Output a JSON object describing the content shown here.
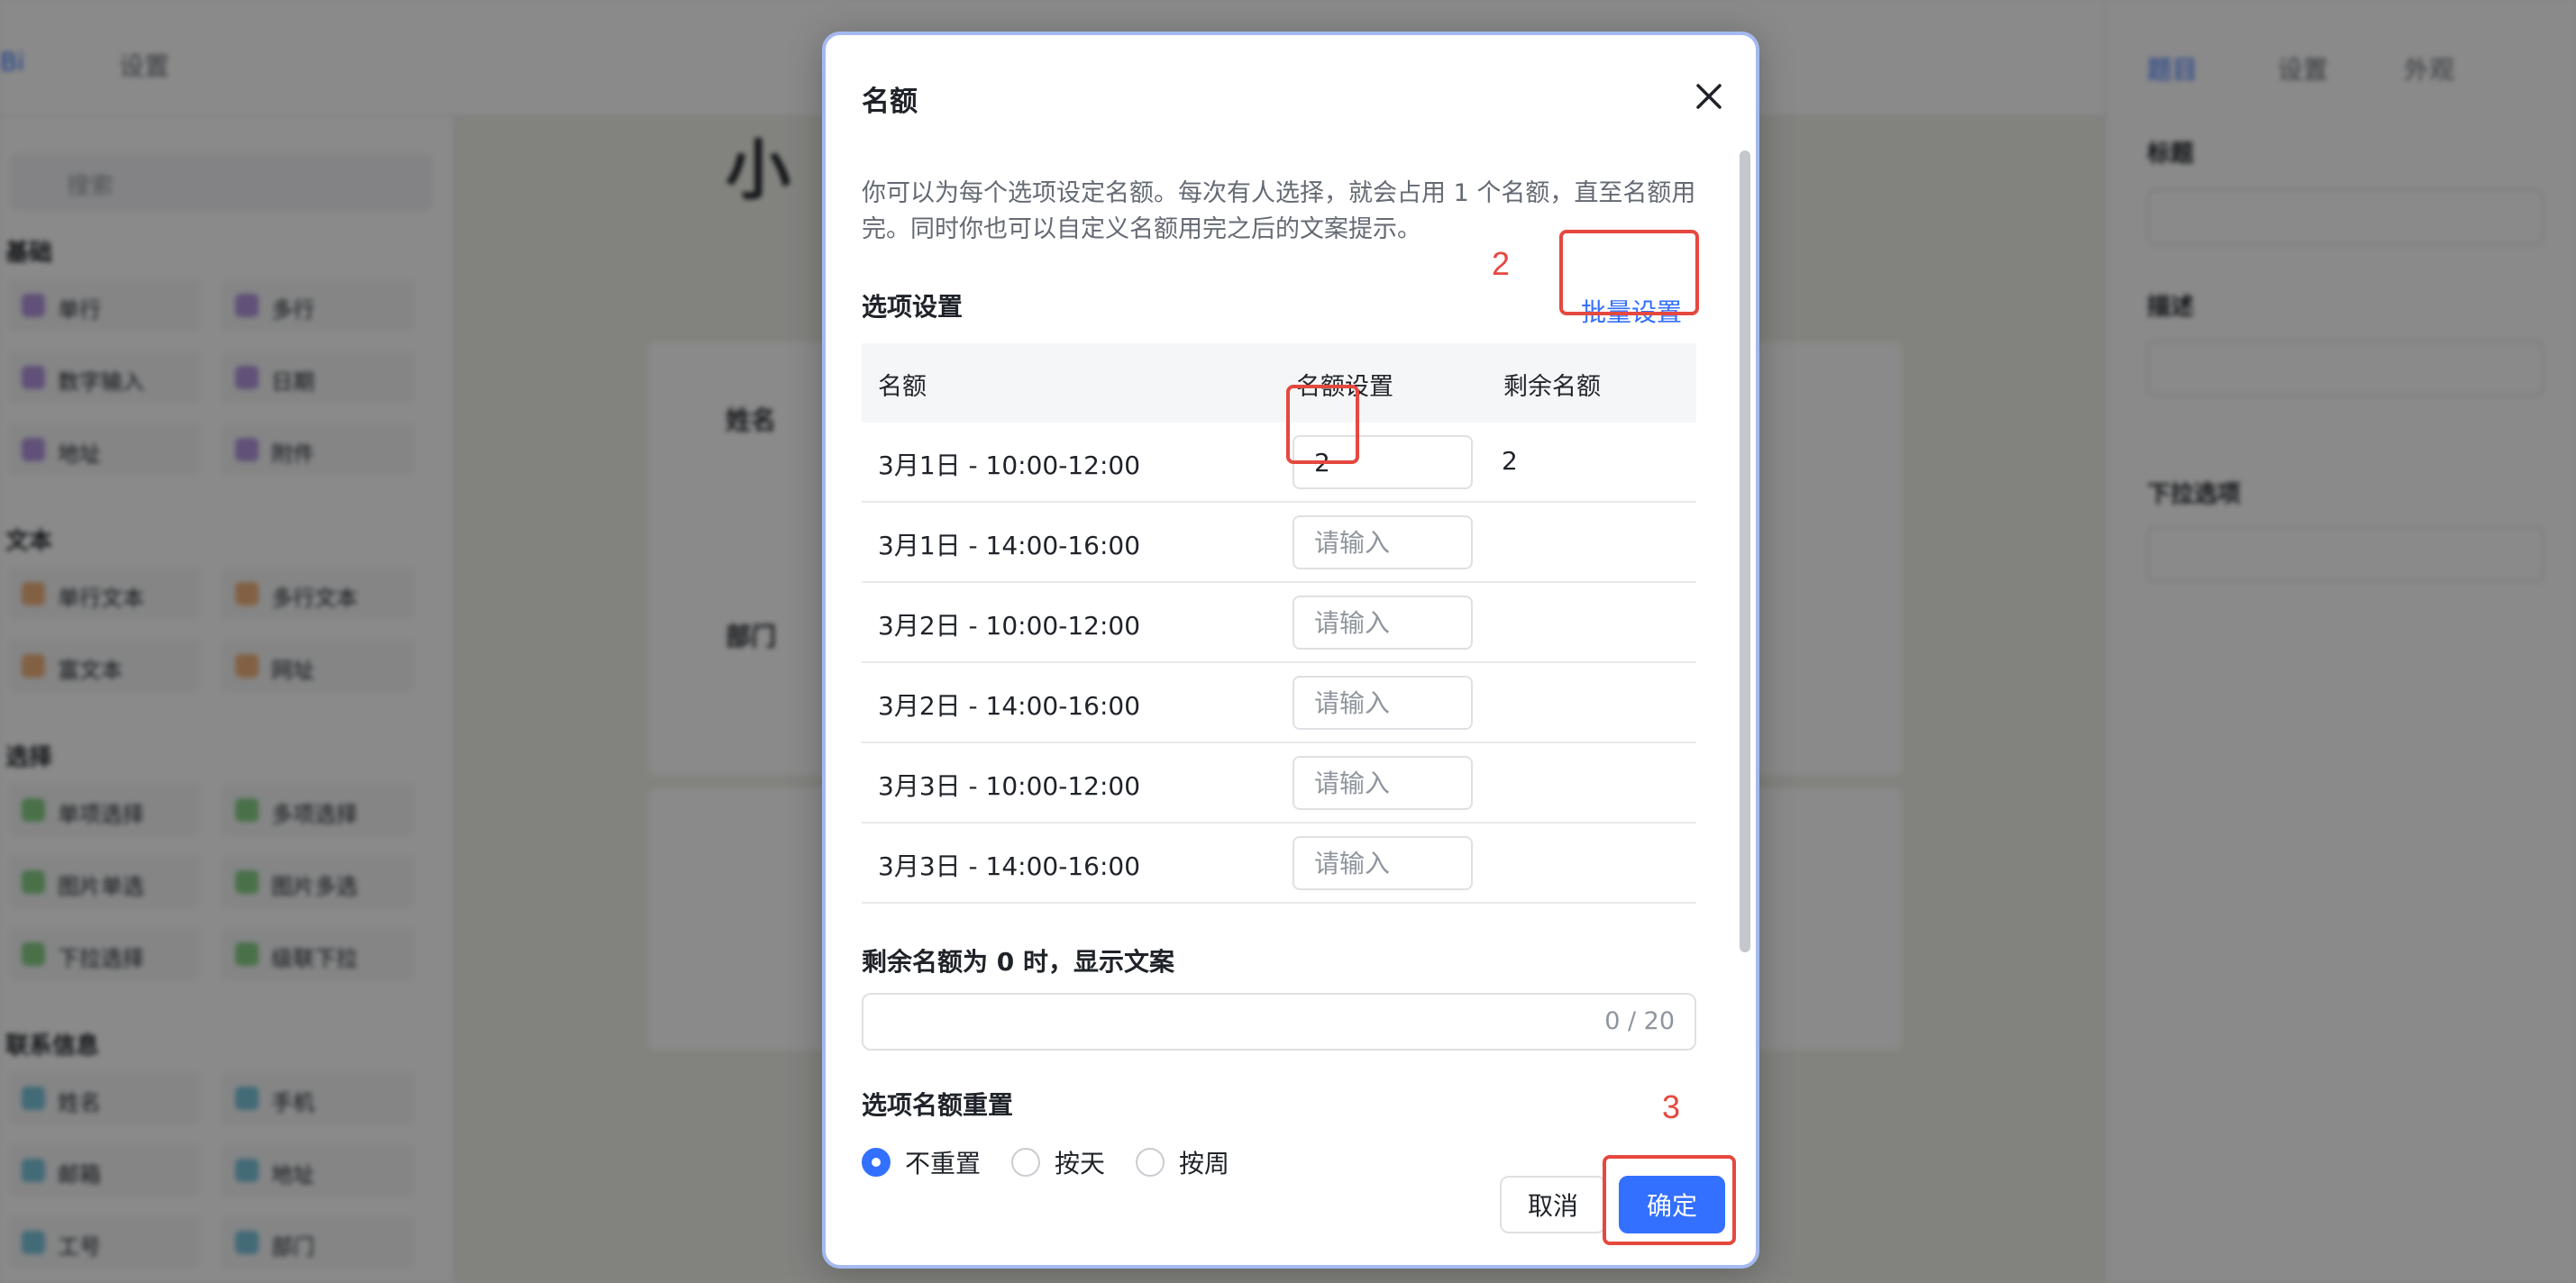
{
  "background": {
    "top_tabs": [
      "Bi",
      "设置"
    ],
    "search_placeholder": "搜索",
    "left_groups": [
      {
        "title": "基础",
        "items": [
          "单行",
          "多行",
          "数字输入",
          "日期",
          "地址",
          "附件"
        ]
      },
      {
        "title": "文本",
        "items": [
          "单行文本",
          "多行文本",
          "富文本",
          "网址"
        ]
      },
      {
        "title": "选择",
        "items": [
          "单项选择",
          "多项选择",
          "图片单选",
          "图片多选",
          "下拉选择",
          "级联下拉"
        ]
      },
      {
        "title": "联系信息",
        "items": [
          "姓名",
          "手机",
          "邮箱",
          "地址",
          "工号",
          "部门"
        ]
      }
    ],
    "page_title": "小",
    "field_labels": [
      "姓名",
      "部门"
    ],
    "right_tabs": [
      "题目",
      "设置",
      "外观"
    ],
    "right_labels": [
      "标题",
      "描述",
      "下拉选项"
    ]
  },
  "modal": {
    "title": "名额",
    "description": "你可以为每个选项设定名额。每次有人选择，就会占用 1 个名额，直至名额用完。同时你也可以自定义名额用完之后的文案提示。",
    "options_section_title": "选项设置",
    "batch_setting_label": "批量设置",
    "table": {
      "columns": [
        "名额",
        "名额设置",
        "剩余名额"
      ],
      "rows": [
        {
          "name": "3月1日 - 10:00-12:00",
          "quota": "2",
          "remaining": "2"
        },
        {
          "name": "3月1日 - 14:00-16:00",
          "quota": "",
          "remaining": ""
        },
        {
          "name": "3月2日 - 10:00-12:00",
          "quota": "",
          "remaining": ""
        },
        {
          "name": "3月2日 - 14:00-16:00",
          "quota": "",
          "remaining": ""
        },
        {
          "name": "3月3日 - 10:00-12:00",
          "quota": "",
          "remaining": ""
        },
        {
          "name": "3月3日 - 14:00-16:00",
          "quota": "",
          "remaining": ""
        }
      ],
      "input_placeholder": "请输入"
    },
    "zero_text_label": "剩余名额为 0 时，显示文案",
    "zero_text_value": "",
    "zero_text_counter": "0 / 20",
    "reset_section_title": "选项名额重置",
    "reset_options": [
      {
        "label": "不重置",
        "checked": true
      },
      {
        "label": "按天",
        "checked": false
      },
      {
        "label": "按周",
        "checked": false
      }
    ],
    "cancel_label": "取消",
    "confirm_label": "确定"
  },
  "annotations": {
    "step2": "2",
    "step3": "3"
  },
  "colors": {
    "primary": "#3370ff",
    "annotation": "#e5483f",
    "overlay": "rgba(0,0,0,0.46)"
  }
}
